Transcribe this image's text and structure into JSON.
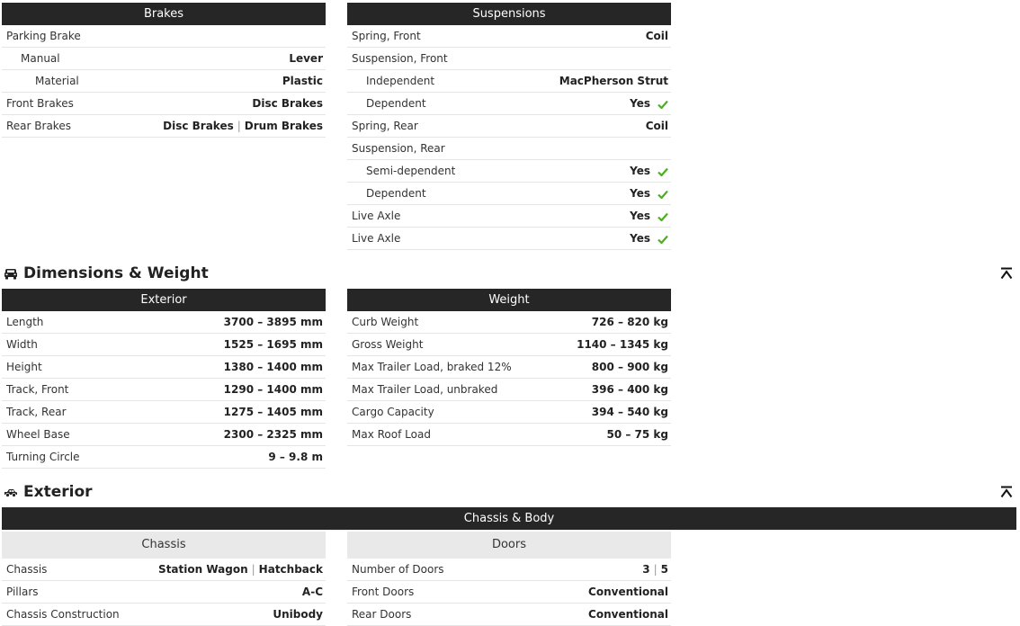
{
  "brakes": {
    "title": "Brakes",
    "rows": [
      {
        "label": "Parking Brake",
        "value": ""
      },
      {
        "label": "Manual",
        "value": "Lever"
      },
      {
        "label": "Material",
        "value": "Plastic"
      },
      {
        "label": "Front Brakes",
        "value": "Disc Brakes"
      },
      {
        "label": "Rear Brakes",
        "value_a": "Disc Brakes",
        "sep": "|",
        "value_b": "Drum Brakes"
      }
    ]
  },
  "suspensions": {
    "title": "Suspensions",
    "rows": [
      {
        "label": "Spring, Front",
        "value": "Coil"
      },
      {
        "label": "Suspension, Front",
        "value": ""
      },
      {
        "label": "Independent",
        "value": "MacPherson Strut"
      },
      {
        "label": "Dependent",
        "value": "Yes"
      },
      {
        "label": "Spring, Rear",
        "value": "Coil"
      },
      {
        "label": "Suspension, Rear",
        "value": ""
      },
      {
        "label": "Semi-dependent",
        "value": "Yes"
      },
      {
        "label": "Dependent",
        "value": "Yes"
      },
      {
        "label": "Live Axle",
        "value": "Yes"
      },
      {
        "label": "Live Axle",
        "value": "Yes"
      }
    ]
  },
  "dimensions": {
    "section_title": "Dimensions & Weight",
    "exterior": {
      "title": "Exterior",
      "rows": [
        {
          "label": "Length",
          "value": "3700 – 3895 mm"
        },
        {
          "label": "Width",
          "value": "1525 – 1695 mm"
        },
        {
          "label": "Height",
          "value": "1380 – 1400 mm"
        },
        {
          "label": "Track, Front",
          "value": "1290 – 1400 mm"
        },
        {
          "label": "Track, Rear",
          "value": "1275 – 1405 mm"
        },
        {
          "label": "Wheel Base",
          "value": "2300 – 2325 mm"
        },
        {
          "label": "Turning Circle",
          "value": "9 – 9.8 m"
        }
      ]
    },
    "weight": {
      "title": "Weight",
      "rows": [
        {
          "label": "Curb Weight",
          "value": "726 – 820 kg"
        },
        {
          "label": "Gross Weight",
          "value": "1140 – 1345 kg"
        },
        {
          "label": "Max Trailer Load, braked 12%",
          "value": "800 – 900 kg"
        },
        {
          "label": "Max Trailer Load, unbraked",
          "value": "396 – 400 kg"
        },
        {
          "label": "Cargo Capacity",
          "value": "394 – 540 kg"
        },
        {
          "label": "Max Roof Load",
          "value": "50 – 75 kg"
        }
      ]
    }
  },
  "exterior_section": {
    "section_title": "Exterior",
    "bar_title": "Chassis & Body",
    "chassis": {
      "title": "Chassis",
      "rows": [
        {
          "label": "Chassis",
          "value_a": "Station Wagon",
          "sep": "|",
          "value_b": "Hatchback"
        },
        {
          "label": "Pillars",
          "value": "A-C"
        },
        {
          "label": "Chassis Construction",
          "value": "Unibody"
        }
      ]
    },
    "doors": {
      "title": "Doors",
      "rows": [
        {
          "label": "Number of Doors",
          "value_a": "3",
          "sep": "|",
          "value_b": "5"
        },
        {
          "label": "Front Doors",
          "value": "Conventional"
        },
        {
          "label": "Rear Doors",
          "value": "Conventional"
        }
      ]
    }
  },
  "colors": {
    "header_bg": "#262626",
    "subheader_bg": "#e9e9e9",
    "check": "#4caf1f"
  },
  "icons": {
    "section_dimensions": "car-front-icon",
    "section_exterior": "car-side-icon",
    "scroll_top": "arrow-up-bar-icon",
    "yes": "check-icon"
  }
}
